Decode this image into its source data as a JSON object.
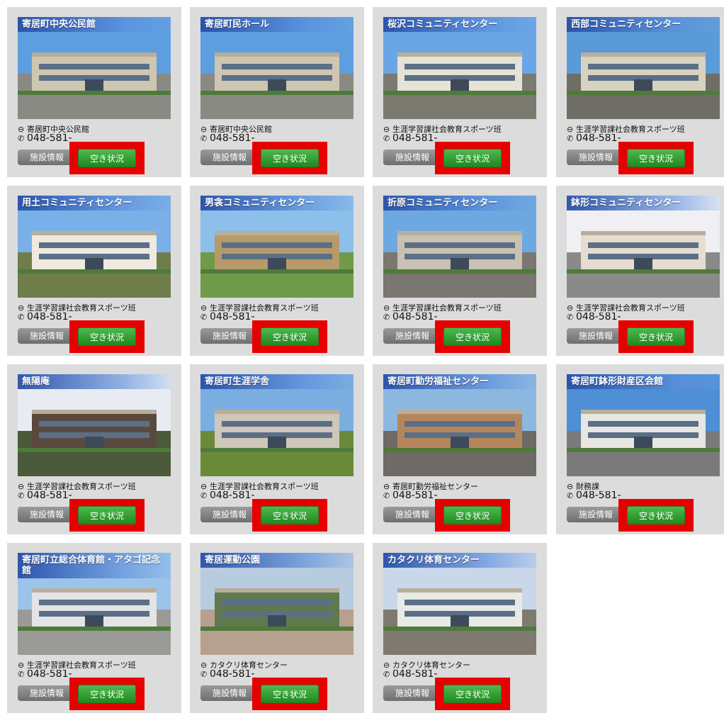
{
  "facilities": [
    {
      "title": "寄居町中央公民館",
      "dept": "寄居町中央公民館",
      "tel": "048-581-"
    },
    {
      "title": "寄居町民ホール",
      "dept": "寄居町中央公民館",
      "tel": "048-581-"
    },
    {
      "title": "桜沢コミュニティセンター",
      "dept": "生涯学習課社会教育スポーツ班",
      "tel": "048-581-"
    },
    {
      "title": "西部コミュニティセンター",
      "dept": "生涯学習課社会教育スポーツ班",
      "tel": "048-581-"
    },
    {
      "title": "用土コミュニティセンター",
      "dept": "生涯学習課社会教育スポーツ班",
      "tel": "048-581-"
    },
    {
      "title": "男衾コミュニティセンター",
      "dept": "生涯学習課社会教育スポーツ班",
      "tel": "048-581-"
    },
    {
      "title": "折原コミュニティセンター",
      "dept": "生涯学習課社会教育スポーツ班",
      "tel": "048-581-"
    },
    {
      "title": "鉢形コミュニティセンター",
      "dept": "生涯学習課社会教育スポーツ班",
      "tel": "048-581-"
    },
    {
      "title": "無陽庵",
      "dept": "生涯学習課社会教育スポーツ班",
      "tel": "048-581-"
    },
    {
      "title": "寄居町生涯学舎",
      "dept": "生涯学習課社会教育スポーツ班",
      "tel": "048-581-"
    },
    {
      "title": "寄居町勤労福祉センター",
      "dept": "寄居町勤労福祉センター",
      "tel": "048-581-"
    },
    {
      "title": "寄居町鉢形財産区会館",
      "dept": "財務課",
      "tel": "048-581-"
    },
    {
      "title": "寄居町立総合体育館・アタゴ記念館",
      "dept": "生涯学習課社会教育スポーツ班",
      "tel": "048-581-"
    },
    {
      "title": "寄居運動公園",
      "dept": "カタクリ体育センター",
      "tel": "048-581-"
    },
    {
      "title": "カタクリ体育センター",
      "dept": "カタクリ体育センター",
      "tel": "048-581-"
    }
  ],
  "labels": {
    "info_button": "施設情報",
    "availability_button": "空き状況"
  },
  "colors": {
    "highlight": "#e60000",
    "availability_green": "#2e9a2e",
    "info_gray": "#808080",
    "card_bg": "#dcdcdc"
  },
  "icons": {
    "person": "person-circle-icon",
    "phone": "phone-icon"
  }
}
